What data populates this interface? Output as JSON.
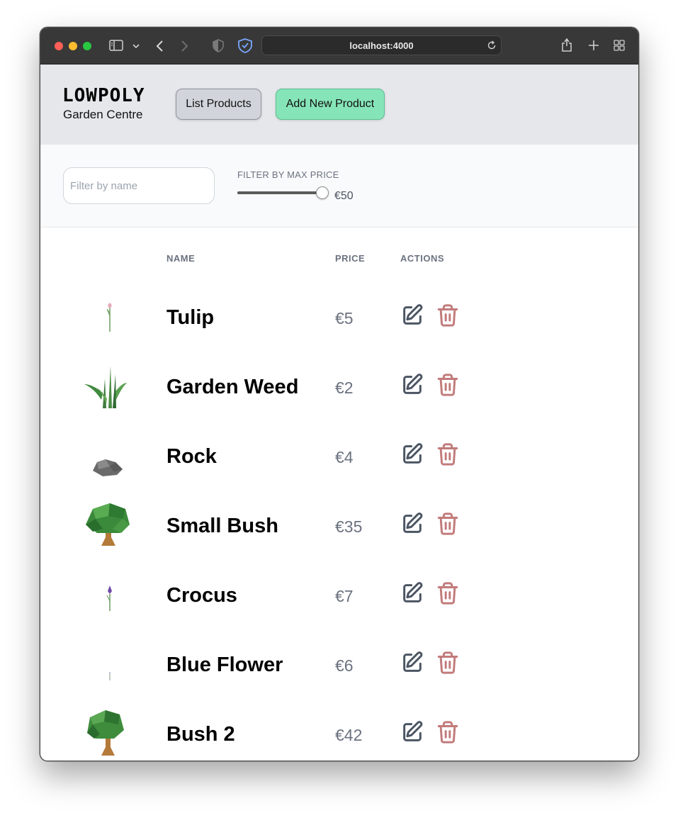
{
  "browser": {
    "url": "localhost:4000",
    "colors": {
      "close": "#ff5f57",
      "minimize": "#febc2e",
      "zoom": "#28c840"
    }
  },
  "header": {
    "logo_title": "LOWPOLY",
    "logo_subtitle": "Garden Centre",
    "list_button": "List Products",
    "add_button": "Add New Product"
  },
  "filters": {
    "name_placeholder": "Filter by name",
    "name_value": "",
    "price_label": "FILTER BY MAX PRICE",
    "price_value": "€50",
    "price_fraction": 1.0
  },
  "table": {
    "headers": {
      "name": "NAME",
      "price": "PRICE",
      "actions": "ACTIONS"
    },
    "rows": [
      {
        "name": "Tulip",
        "price": "€5",
        "image": "tulip"
      },
      {
        "name": "Garden Weed",
        "price": "€2",
        "image": "weed"
      },
      {
        "name": "Rock",
        "price": "€4",
        "image": "rock"
      },
      {
        "name": "Small Bush",
        "price": "€35",
        "image": "small-bush"
      },
      {
        "name": "Crocus",
        "price": "€7",
        "image": "crocus"
      },
      {
        "name": "Blue Flower",
        "price": "€6",
        "image": "blue-flower"
      },
      {
        "name": "Bush 2",
        "price": "€42",
        "image": "bush"
      }
    ]
  },
  "colors": {
    "edit_icon": "#4b5563",
    "delete_icon": "#c27b7b",
    "add_button": "#86e5b8",
    "header_bg": "#e5e7eb"
  }
}
